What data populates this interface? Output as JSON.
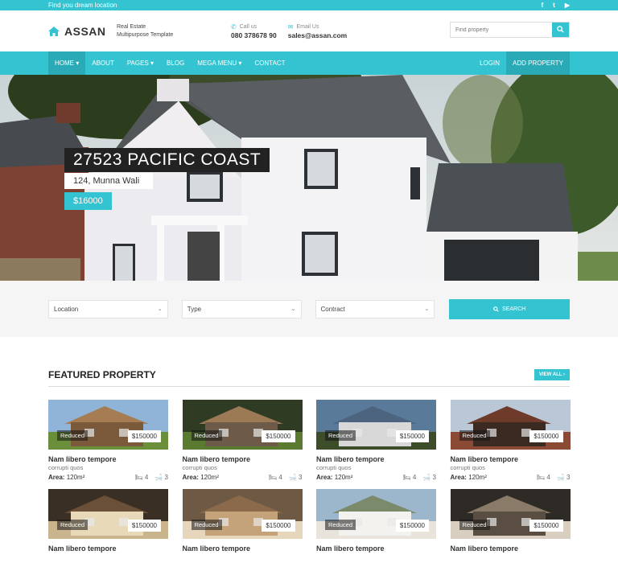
{
  "topbar": {
    "tagline": "Find you dream location",
    "social": [
      "f",
      "t",
      "▶"
    ]
  },
  "header": {
    "logo": "ASSAN",
    "tagline_line1": "Real Estate",
    "tagline_line2": "Multipurpose Template",
    "call_label": "Call us",
    "phone": "080 378678 90",
    "email_label": "Email Us",
    "email": "sales@assan.com",
    "search_placeholder": "Find property"
  },
  "nav": {
    "left": [
      "HOME ▾",
      "ABOUT",
      "PAGES ▾",
      "BLOG",
      "MEGA MENU ▾",
      "CONTACT"
    ],
    "right": [
      "LOGIN",
      "ADD PROPERTY"
    ]
  },
  "hero": {
    "title": "27523 PACIFIC COAST",
    "address": "124, Munna Wali",
    "price": "$16000"
  },
  "search": {
    "location": "Location",
    "type": "Type",
    "contract": "Contract",
    "button": "SEARCH"
  },
  "featured": {
    "heading": "FEATURED PROPERTY",
    "view_all": "VIEW ALL  ›",
    "cards": [
      {
        "badge": "Reduced",
        "price": "$150000",
        "title": "Nam libero tempore",
        "subtitle": "corrupti quos",
        "area_label": "Area:",
        "area": "120m²",
        "beds": "4",
        "baths": "3"
      },
      {
        "badge": "Reduced",
        "price": "$150000",
        "title": "Nam libero tempore",
        "subtitle": "corrupti quos",
        "area_label": "Area:",
        "area": "120m²",
        "beds": "4",
        "baths": "3"
      },
      {
        "badge": "Reduced",
        "price": "$150000",
        "title": "Nam libero tempore",
        "subtitle": "corrupti quos",
        "area_label": "Area:",
        "area": "120m²",
        "beds": "4",
        "baths": "3"
      },
      {
        "badge": "Reduced",
        "price": "$150000",
        "title": "Nam libero tempore",
        "subtitle": "corrupti quos",
        "area_label": "Area:",
        "area": "120m²",
        "beds": "4",
        "baths": "3"
      },
      {
        "badge": "Reduced",
        "price": "$150000",
        "title": "Nam libero tempore"
      },
      {
        "badge": "Reduced",
        "price": "$150000",
        "title": "Nam libero tempore"
      },
      {
        "badge": "Reduced",
        "price": "$150000",
        "title": "Nam libero tempore"
      },
      {
        "badge": "Reduced",
        "price": "$150000",
        "title": "Nam libero tempore"
      }
    ]
  },
  "colors": {
    "accent": "#33c3d1",
    "accent_dark": "#2aaab6"
  }
}
